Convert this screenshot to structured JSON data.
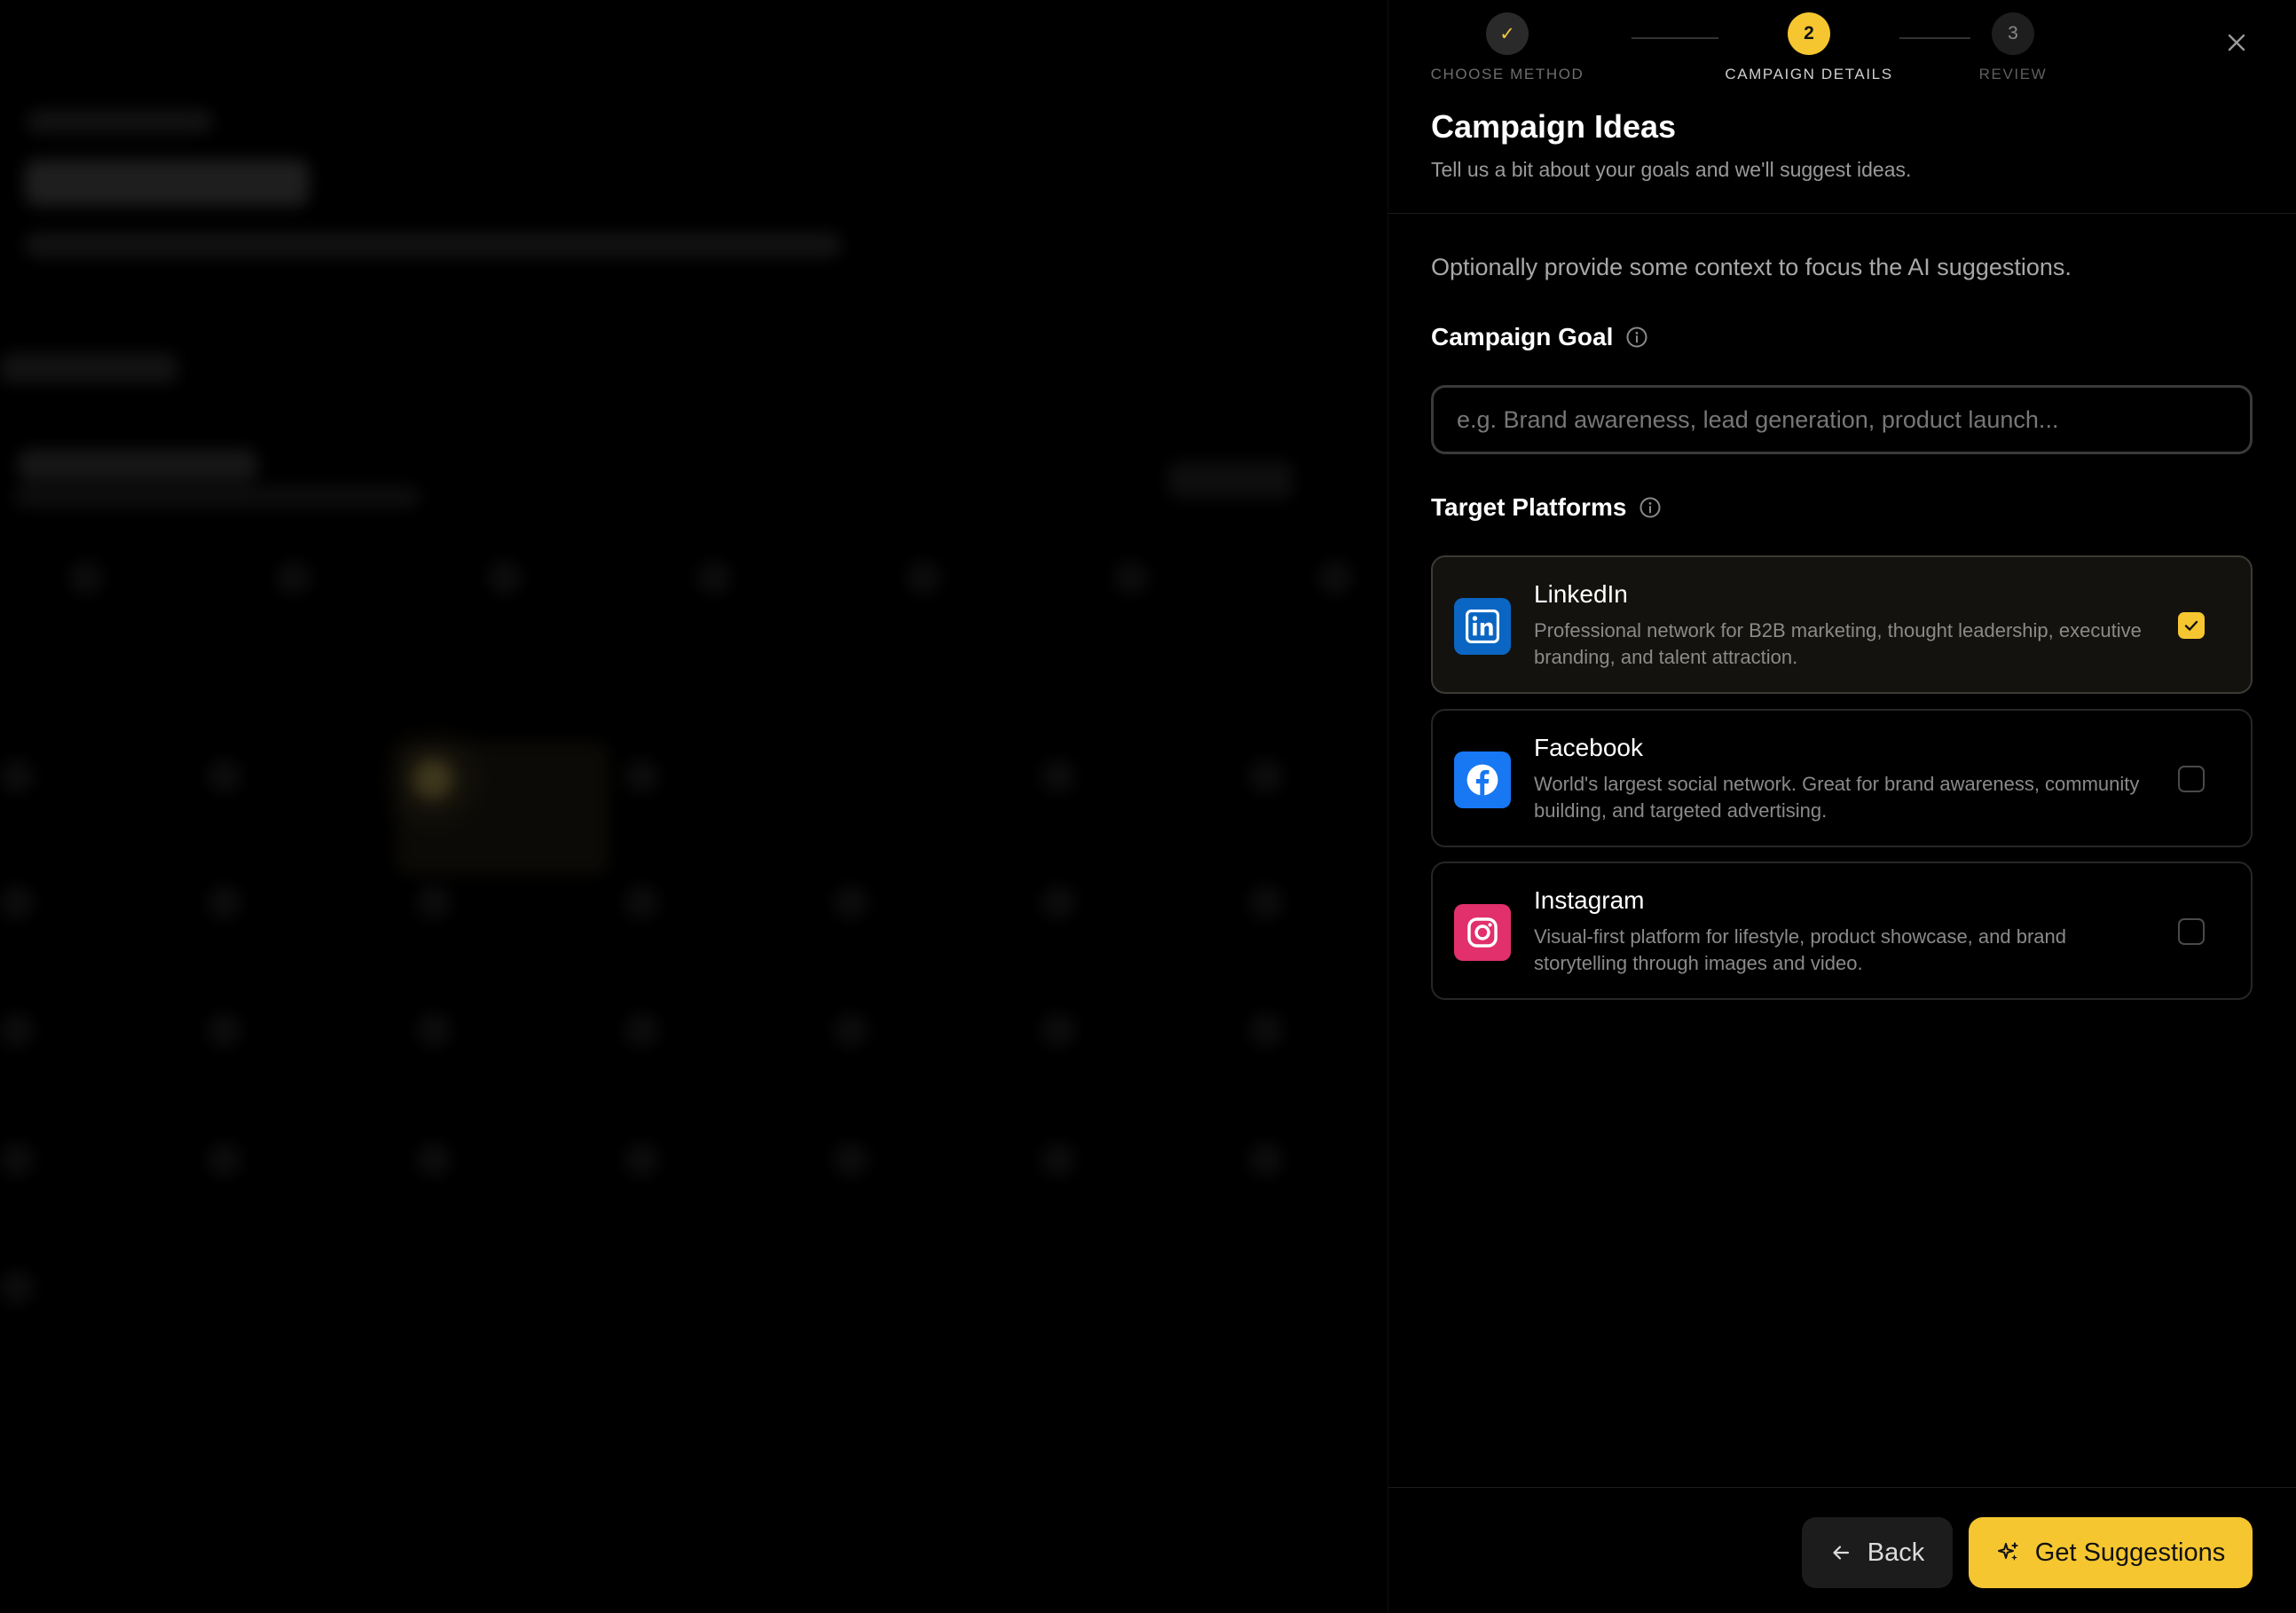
{
  "stepper": {
    "steps": [
      {
        "label": "CHOOSE METHOD",
        "marker": "✓",
        "state": "done"
      },
      {
        "label": "CAMPAIGN DETAILS",
        "marker": "2",
        "state": "active"
      },
      {
        "label": "REVIEW",
        "marker": "3",
        "state": "todo"
      }
    ]
  },
  "panel": {
    "title": "Campaign Ideas",
    "subtitle": "Tell us a bit about your goals and we'll suggest ideas.",
    "intro": "Optionally provide some context to focus the AI suggestions."
  },
  "goal": {
    "label": "Campaign Goal",
    "placeholder": "e.g. Brand awareness, lead generation, product launch...",
    "value": ""
  },
  "platforms": {
    "label": "Target Platforms",
    "items": [
      {
        "name": "LinkedIn",
        "description": "Professional network for B2B marketing, thought leadership, executive branding, and talent attraction.",
        "selected": true,
        "icon": "linkedin-icon",
        "color": "#0a66c2"
      },
      {
        "name": "Facebook",
        "description": "World's largest social network. Great for brand awareness, community building, and targeted advertising.",
        "selected": false,
        "icon": "facebook-icon",
        "color": "#1877f2"
      },
      {
        "name": "Instagram",
        "description": "Visual-first platform for lifestyle, product showcase, and brand storytelling through images and video.",
        "selected": false,
        "icon": "instagram-icon",
        "color": "#e1306c"
      }
    ]
  },
  "footer": {
    "back_label": "Back",
    "submit_label": "Get Suggestions"
  },
  "colors": {
    "accent": "#f5c630",
    "background": "#000000"
  }
}
